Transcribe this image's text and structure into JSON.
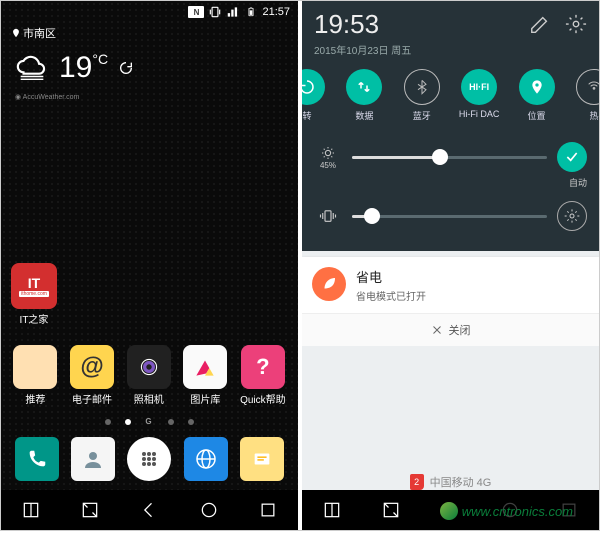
{
  "left": {
    "status": {
      "time": "21:57",
      "nfc_badge": "N"
    },
    "location": "市南区",
    "weather": {
      "temp": "19",
      "unit": "°C",
      "source": "AccuWeather.com"
    },
    "solo_app": {
      "label": "IT之家",
      "badge": "IT"
    },
    "apps": [
      {
        "label": "推荐"
      },
      {
        "label": "电子邮件"
      },
      {
        "label": "照相机"
      },
      {
        "label": "图片库"
      },
      {
        "label": "Quick帮助"
      }
    ],
    "pager_brand": "G",
    "dock": [
      {
        "name": "phone"
      },
      {
        "name": "contacts"
      },
      {
        "name": "apps"
      },
      {
        "name": "browser"
      },
      {
        "name": "messages"
      }
    ]
  },
  "right": {
    "time": "19:53",
    "date": "2015年10月23日 周五",
    "toggles": [
      {
        "label": "转",
        "icon": "rotate",
        "on": true
      },
      {
        "label": "数据",
        "icon": "data",
        "on": true
      },
      {
        "label": "蓝牙",
        "icon": "bt",
        "on": false
      },
      {
        "label": "Hi-Fi DAC",
        "icon": "hifi",
        "text": "HI·FI",
        "on": true
      },
      {
        "label": "位置",
        "icon": "loc",
        "on": true
      },
      {
        "label": "热",
        "icon": "hotspot",
        "on": false
      }
    ],
    "brightness": {
      "label": "45%",
      "value": 45,
      "auto_on": true
    },
    "volume": {
      "value": 10,
      "icon": "vibrate"
    },
    "notif": {
      "title": "省电",
      "body": "省电模式已打开",
      "close": "关闭"
    },
    "carrier": {
      "sim": "2",
      "text": "中国移动 4G"
    }
  },
  "watermark": "www.cntronics.com",
  "colors": {
    "teal": "#00bfa5",
    "dark": "#263238",
    "orange": "#ff7043",
    "red": "#e53935"
  }
}
